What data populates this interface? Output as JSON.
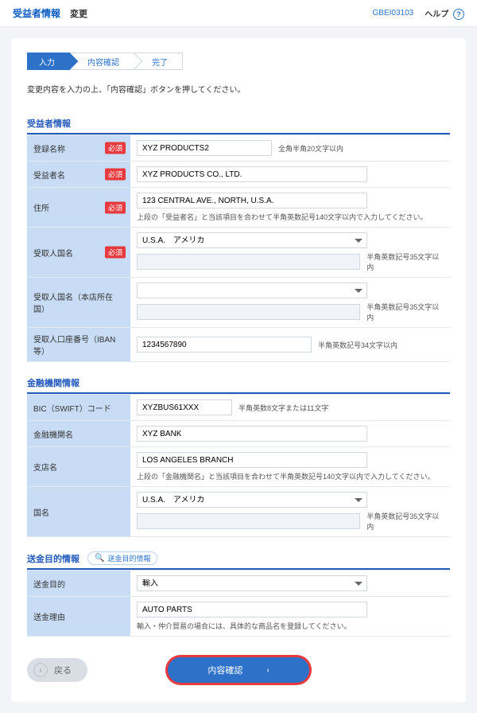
{
  "header": {
    "title": "受益者情報",
    "subtitle": "変更",
    "screen_id": "GBEI03103",
    "help_label": "ヘルプ",
    "help_icon_glyph": "?"
  },
  "steps": {
    "s1": "入力",
    "s2": "内容確認",
    "s3": "完了"
  },
  "intro": "変更内容を入力の上、「内容確認」ボタンを押してください。",
  "required_badge": "必須",
  "beneficiary": {
    "section_title": "受益者情報",
    "reg_name": {
      "label": "登録名称",
      "value": "XYZ PRODUCTS2",
      "hint": "全角半角20文字以内"
    },
    "name": {
      "label": "受益者名",
      "value": "XYZ PRODUCTS CO., LTD."
    },
    "address": {
      "label": "住所",
      "value": "123 CENTRAL AVE., NORTH, U.S.A.",
      "hint": "上段の「受益者名」と当該項目を合わせて半角英数記号140文字以内で入力してください。"
    },
    "country": {
      "label": "受取人国名",
      "value": "U.S.A.　アメリカ",
      "sub_value": "",
      "sub_hint": "半角英数記号35文字以内"
    },
    "origin_country": {
      "label": "受取人国名（本店所在国）",
      "value": "",
      "sub_value": "",
      "sub_hint": "半角英数記号35文字以内"
    },
    "account": {
      "label": "受取人口座番号（IBAN等）",
      "value": "1234567890",
      "hint": "半角英数記号34文字以内"
    }
  },
  "bank": {
    "section_title": "金融機関情報",
    "bic": {
      "label": "BIC（SWIFT）コード",
      "value": "XYZBUS61XXX",
      "hint": "半角英数8文字または11文字"
    },
    "name": {
      "label": "金融機関名",
      "value": "XYZ BANK"
    },
    "branch": {
      "label": "支店名",
      "value": "LOS ANGELES BRANCH",
      "hint": "上段の「金融機関名」と当該項目を合わせて半角英数記号140文字以内で入力してください。"
    },
    "country": {
      "label": "国名",
      "value": "U.S.A.　アメリカ",
      "sub_value": "",
      "sub_hint": "半角英数記号35文字以内"
    }
  },
  "remit": {
    "section_title": "送金目的情報",
    "info_button": "送金目的情報",
    "purpose": {
      "label": "送金目的",
      "value": "輸入"
    },
    "reason": {
      "label": "送金理由",
      "value": "AUTO PARTS",
      "hint": "輸入・仲介貿易の場合には、具体的な商品名を登録してください。"
    }
  },
  "buttons": {
    "back": "戻る",
    "confirm": "内容確認"
  }
}
